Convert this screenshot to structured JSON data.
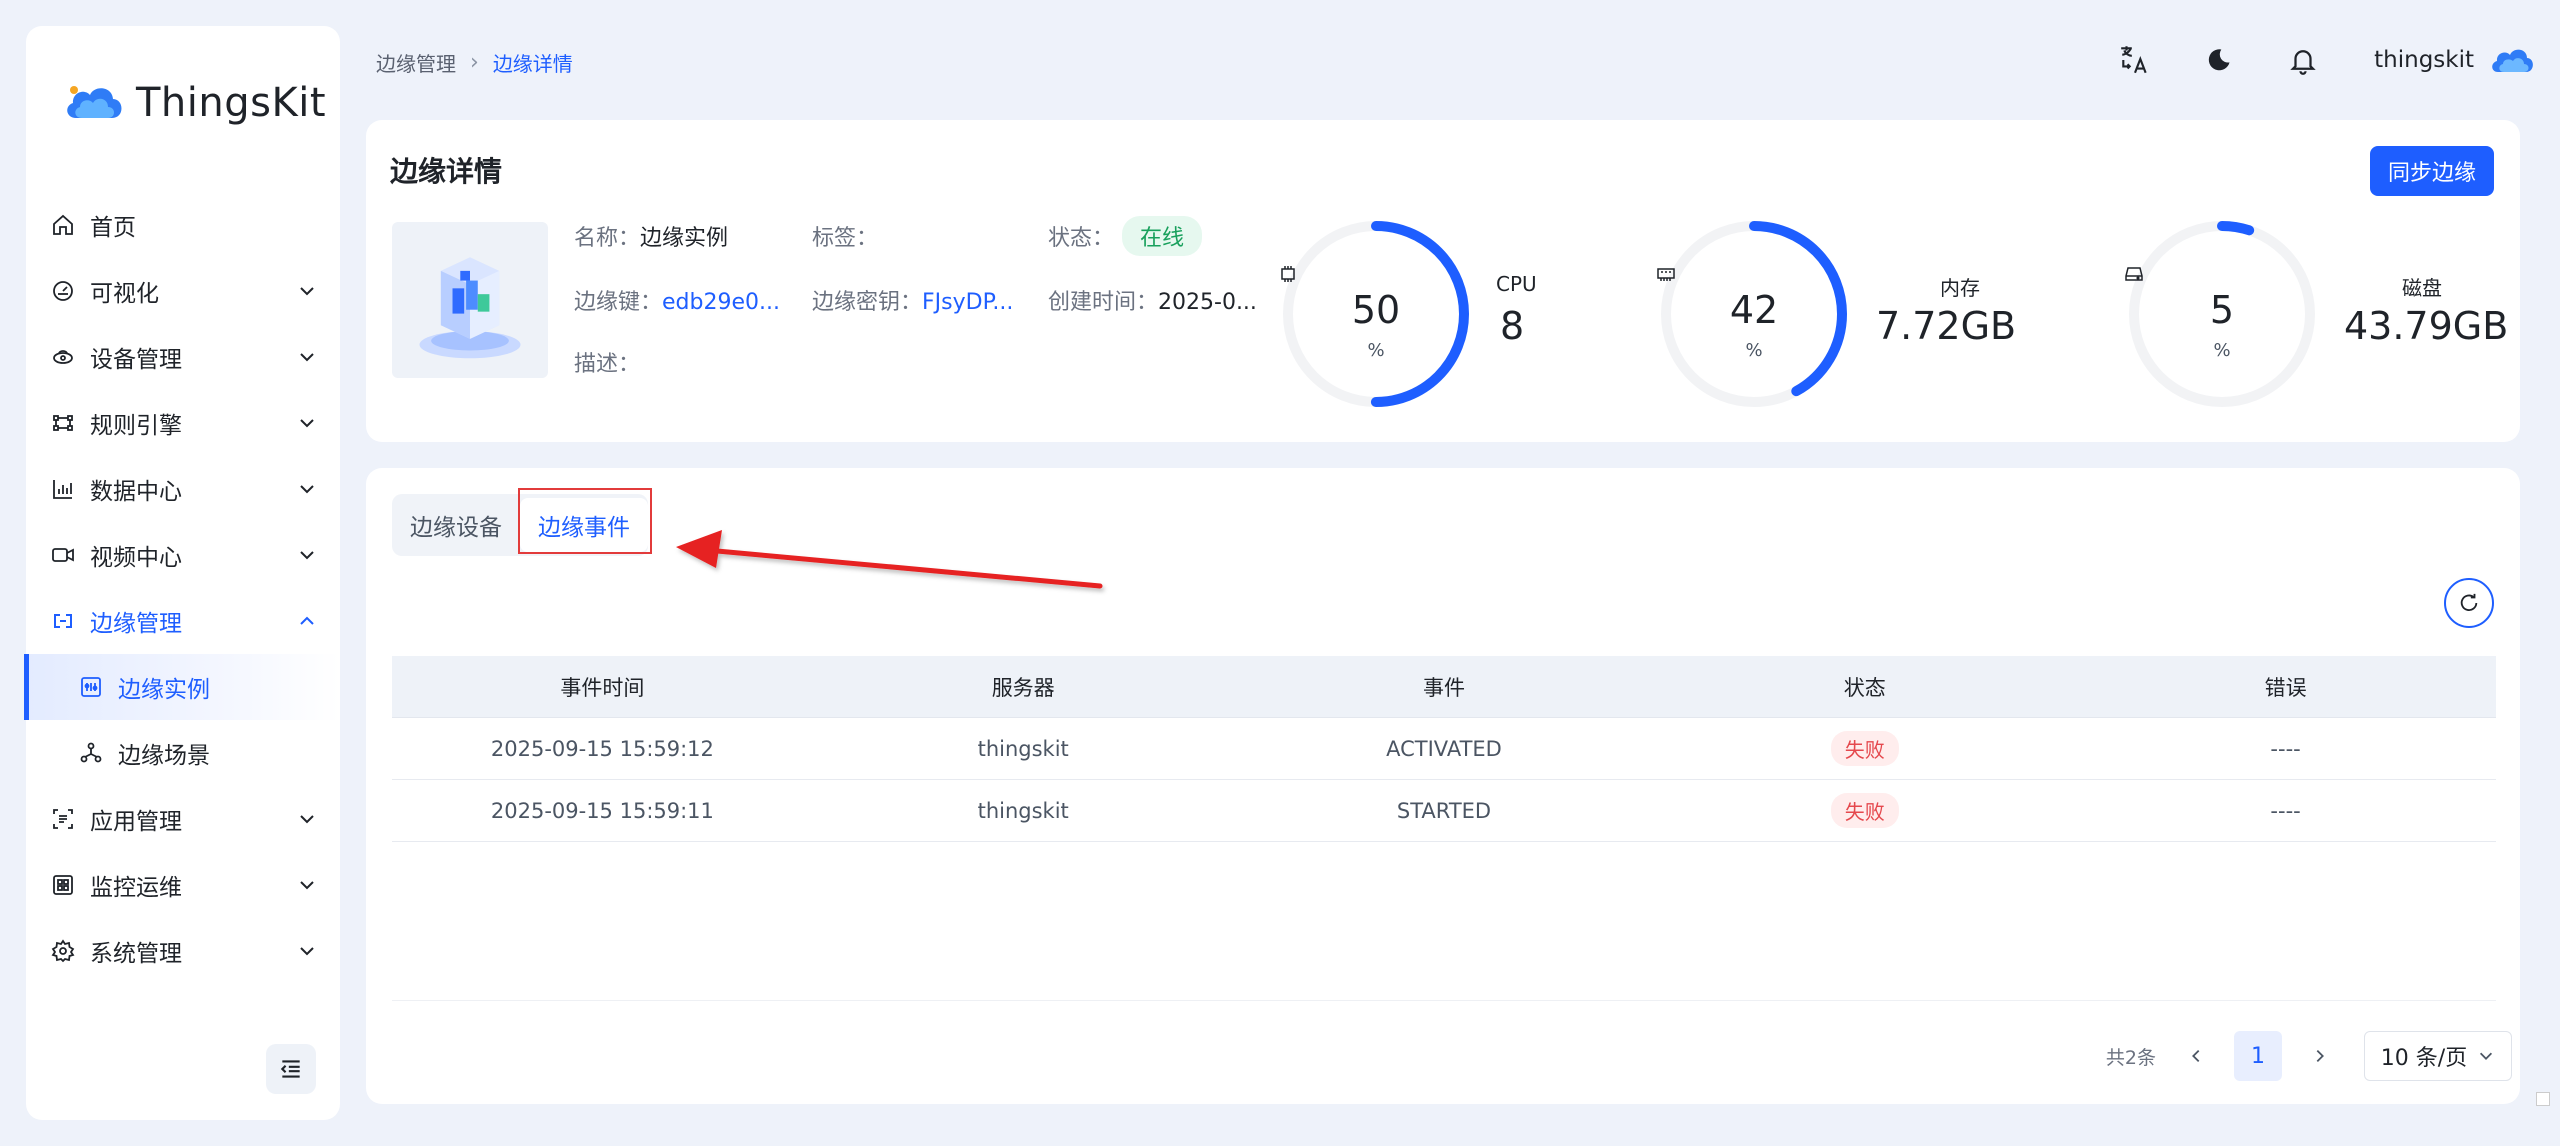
{
  "app": {
    "name": "ThingsKit"
  },
  "sidebar": {
    "items": [
      {
        "label": "首页",
        "icon": "home-icon",
        "has_chevron": false
      },
      {
        "label": "可视化",
        "icon": "dashboard-icon",
        "has_chevron": true
      },
      {
        "label": "设备管理",
        "icon": "device-icon",
        "has_chevron": true
      },
      {
        "label": "规则引擎",
        "icon": "rule-icon",
        "has_chevron": true
      },
      {
        "label": "数据中心",
        "icon": "chart-icon",
        "has_chevron": true
      },
      {
        "label": "视频中心",
        "icon": "video-icon",
        "has_chevron": true
      },
      {
        "label": "边缘管理",
        "icon": "edge-icon",
        "has_chevron": true,
        "expanded": true
      },
      {
        "label": "边缘实例",
        "icon": "instance-icon",
        "sub": true,
        "active": true
      },
      {
        "label": "边缘场景",
        "icon": "scene-icon",
        "sub": true
      },
      {
        "label": "应用管理",
        "icon": "app-icon",
        "has_chevron": true
      },
      {
        "label": "监控运维",
        "icon": "monitor-icon",
        "has_chevron": true
      },
      {
        "label": "系统管理",
        "icon": "settings-icon",
        "has_chevron": true
      }
    ]
  },
  "breadcrumb": {
    "parent": "边缘管理",
    "current": "边缘详情"
  },
  "header": {
    "username": "thingskit"
  },
  "detail": {
    "title": "边缘详情",
    "sync_button": "同步边缘",
    "name_label": "名称：",
    "name_value": "边缘实例",
    "tag_label": "标签：",
    "status_label": "状态：",
    "status_value": "在线",
    "key_label": "边缘键：",
    "key_value": "edb29e0...",
    "secret_label": "边缘密钥：",
    "secret_value": "FJsyDP...",
    "created_label": "创建时间：",
    "created_value": "2025-0...",
    "desc_label": "描述："
  },
  "metrics": [
    {
      "name": "cpu",
      "gauge_value": "50",
      "percent": 50,
      "unit": "%",
      "label": "CPU",
      "value": "8"
    },
    {
      "name": "memory",
      "gauge_value": "42",
      "percent": 42,
      "unit": "%",
      "label": "内存",
      "value": "7.72GB"
    },
    {
      "name": "disk",
      "gauge_value": "5",
      "percent": 5,
      "unit": "%",
      "label": "磁盘",
      "value": "43.79GB"
    }
  ],
  "colors": {
    "accent": "#1e5eff",
    "success": "#18a05c",
    "danger": "#e5484d",
    "annotation": "#e23b3b"
  },
  "tabs": [
    {
      "label": "边缘设备"
    },
    {
      "label": "边缘事件"
    }
  ],
  "table": {
    "headers": [
      "事件时间",
      "服务器",
      "事件",
      "状态",
      "错误"
    ],
    "rows": [
      [
        "2025-09-15 15:59:12",
        "thingskit",
        "ACTIVATED",
        "失败",
        "----"
      ],
      [
        "2025-09-15 15:59:11",
        "thingskit",
        "STARTED",
        "失败",
        "----"
      ]
    ]
  },
  "pagination": {
    "total": "共2条",
    "current": "1",
    "page_size": "10 条/页"
  }
}
